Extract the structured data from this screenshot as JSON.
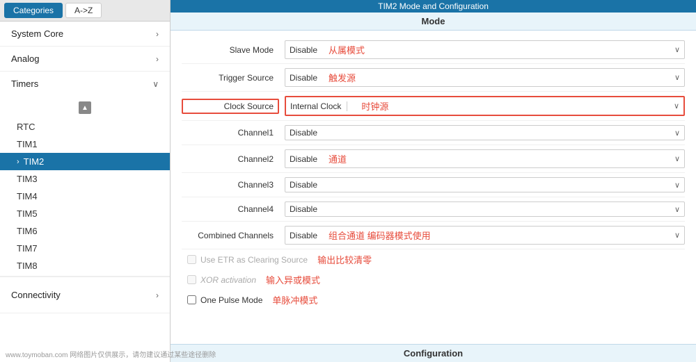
{
  "sidebar": {
    "tabs": [
      {
        "label": "Categories",
        "active": true
      },
      {
        "label": "A->Z",
        "active": false
      }
    ],
    "sections": [
      {
        "name": "System Core",
        "expanded": false,
        "items": []
      },
      {
        "name": "Analog",
        "expanded": false,
        "items": []
      },
      {
        "name": "Timers",
        "expanded": true,
        "items": [
          "RTC",
          "TIM1",
          "TIM2",
          "TIM3",
          "TIM4",
          "TIM5",
          "TIM6",
          "TIM7",
          "TIM8"
        ]
      },
      {
        "name": "Connectivity",
        "expanded": false,
        "items": []
      }
    ],
    "active_item": "TIM2"
  },
  "main": {
    "header": "TIM2 Mode and Configuration",
    "mode_section": "Mode",
    "rows": [
      {
        "label": "Slave Mode",
        "value": "Disable",
        "annotation": "从属模式",
        "highlight": false
      },
      {
        "label": "Trigger Source",
        "value": "Disable",
        "annotation": "触发源",
        "highlight": false
      },
      {
        "label": "Clock Source",
        "value": "Internal Clock",
        "annotation": "时钟源",
        "highlight": true
      },
      {
        "label": "Channel1",
        "value": "Disable",
        "annotation": "",
        "highlight": false
      },
      {
        "label": "Channel2",
        "value": "Disable",
        "annotation": "通道",
        "highlight": false
      },
      {
        "label": "Channel3",
        "value": "Disable",
        "annotation": "",
        "highlight": false
      },
      {
        "label": "Channel4",
        "value": "Disable",
        "annotation": "",
        "highlight": false
      },
      {
        "label": "Combined Channels",
        "value": "Disable",
        "annotation": "组合通道 编码器模式使用",
        "highlight": false
      }
    ],
    "checkboxes": [
      {
        "label": "Use ETR as Clearing Source",
        "annotation": "输出比较清零",
        "checked": false,
        "disabled": true
      },
      {
        "label": "XOR activation",
        "annotation": "输入异或模式",
        "checked": false,
        "disabled": true
      },
      {
        "label": "One Pulse Mode",
        "annotation": "单脉冲模式",
        "checked": false,
        "disabled": false
      }
    ],
    "bottom_section": "Configuration"
  },
  "watermark": "www.toymoban.com 网络图片仅供展示，请勿建议通过某些途径删除"
}
